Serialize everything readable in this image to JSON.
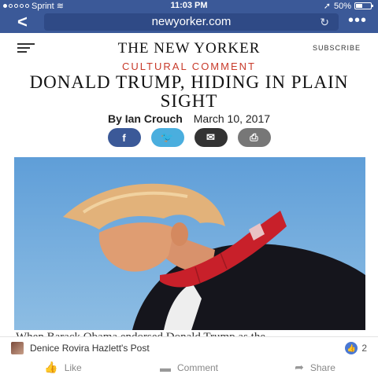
{
  "status_bar": {
    "carrier": "Sprint",
    "time": "11:03 PM",
    "battery_percent": "50%",
    "battery_level": 0.5
  },
  "browser": {
    "url": "newyorker.com",
    "back_icon": "chevron-left-icon",
    "more_icon": "ellipsis-icon"
  },
  "site": {
    "masthead": "THE NEW YORKER",
    "subscribe_label": "SUBSCRIBE"
  },
  "article": {
    "rubric": "CULTURAL COMMENT",
    "headline": "DONALD TRUMP, HIDING IN PLAIN SIGHT",
    "author": "By Ian Crouch",
    "date": "March 10, 2017",
    "caption_peek": "When Barack Obama endorsed Donald Trump as the..."
  },
  "share": {
    "facebook": "f",
    "twitter": "🐦",
    "email": "✉",
    "print": "⎙"
  },
  "facebook_bar": {
    "post_owner": "Denice Rovira Hazlett's Post",
    "like_count": "2",
    "like_label": "Like",
    "comment_label": "Comment",
    "share_label": "Share"
  },
  "colors": {
    "facebook_blue": "#3b5998",
    "rubric_red": "#c83a2a",
    "twitter_blue": "#4aaede"
  }
}
